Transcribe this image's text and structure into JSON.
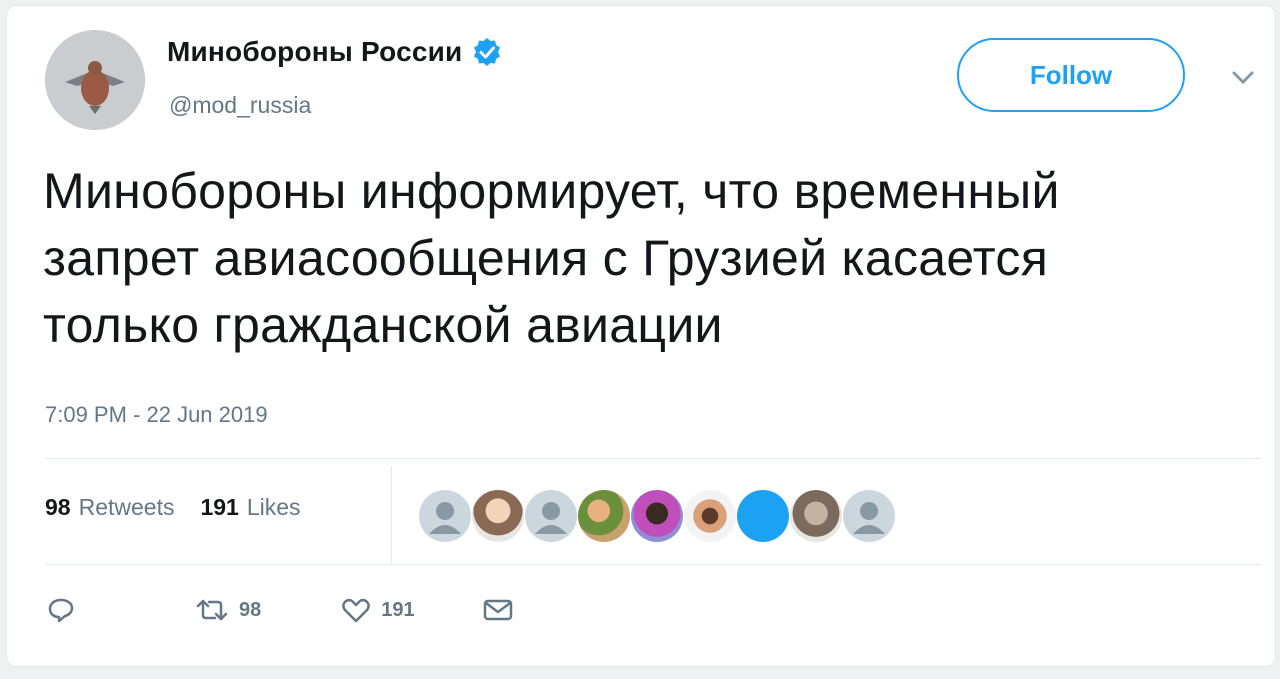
{
  "account": {
    "display_name": "Минобороны России",
    "handle": "@mod_russia",
    "verified": true
  },
  "follow_button": {
    "label": "Follow"
  },
  "tweet": {
    "text_lines": [
      "Минобороны информирует, что временный",
      "запрет авиасообщения с Грузией касается",
      "только гражданской авиации"
    ],
    "timestamp": "7:09 PM - 22 Jun 2019"
  },
  "stats": {
    "retweets_count": "98",
    "retweets_label": "Retweets",
    "likes_count": "191",
    "likes_label": "Likes"
  },
  "likers": [
    "default-avatar",
    "photo-avatar",
    "default-avatar",
    "photo-avatar",
    "photo-avatar",
    "photo-avatar",
    "blue-avatar",
    "photo-avatar",
    "default-avatar"
  ],
  "actions": {
    "reply_icon": "reply-icon",
    "retweet_icon": "retweet-icon",
    "retweet_count": "98",
    "like_icon": "heart-icon",
    "like_count": "191",
    "dm_icon": "envelope-icon"
  },
  "colors": {
    "accent": "#1da1f2",
    "text": "#14171a",
    "secondary": "#657786",
    "border": "#e1e8ed"
  }
}
